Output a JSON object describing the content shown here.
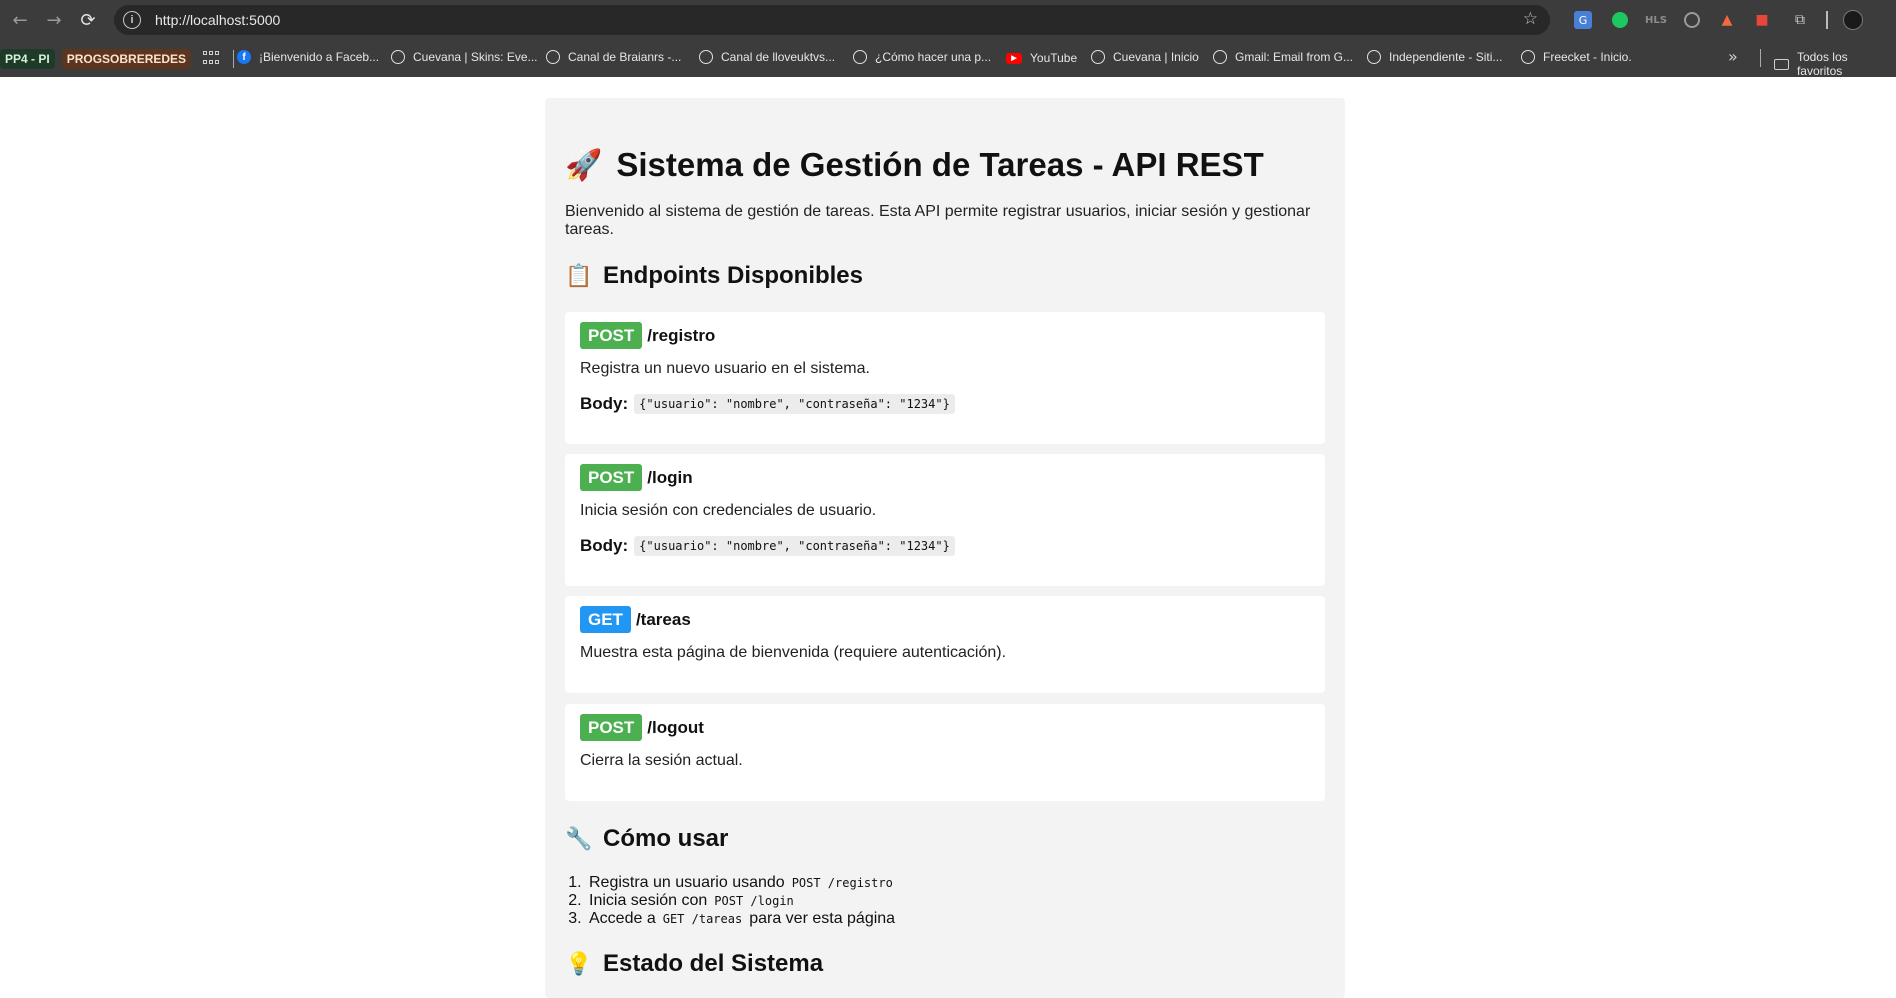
{
  "browser": {
    "url": "http://localhost:5000",
    "bookmark_groups": [
      "PP4 - PI",
      "PROGSOBREREDES"
    ],
    "bookmarks": [
      {
        "label": "¡Bienvenido a Faceb...",
        "icon": "facebook-icon"
      },
      {
        "label": "Cuevana | Skins: Eve...",
        "icon": "globe-icon"
      },
      {
        "label": "Canal de Braianrs -...",
        "icon": "globe-icon"
      },
      {
        "label": "Canal de lloveuktvs...",
        "icon": "globe-icon"
      },
      {
        "label": "¿Cómo hacer una p...",
        "icon": "globe-icon"
      },
      {
        "label": "YouTube",
        "icon": "youtube-icon"
      },
      {
        "label": "Cuevana | Inicio",
        "icon": "globe-icon"
      },
      {
        "label": "Gmail: Email from G...",
        "icon": "globe-icon"
      },
      {
        "label": "Independiente - Siti...",
        "icon": "globe-icon"
      },
      {
        "label": "Freecket - Inicio.",
        "icon": "globe-icon"
      }
    ],
    "all_bookmarks_label": "Todos los favoritos",
    "hls_label": "HLS"
  },
  "page": {
    "title_emoji": "🚀",
    "title": "Sistema de Gestión de Tareas - API REST",
    "intro": "Bienvenido al sistema de gestión de tareas. Esta API permite registrar usuarios, iniciar sesión y gestionar tareas.",
    "endpoints_heading_emoji": "📋",
    "endpoints_heading": "Endpoints Disponibles",
    "endpoints": [
      {
        "method": "POST",
        "path": "/registro",
        "description": "Registra un nuevo usuario en el sistema.",
        "body_label": "Body:",
        "body": "{\"usuario\": \"nombre\", \"contraseña\": \"1234\"}"
      },
      {
        "method": "POST",
        "path": "/login",
        "description": "Inicia sesión con credenciales de usuario.",
        "body_label": "Body:",
        "body": "{\"usuario\": \"nombre\", \"contraseña\": \"1234\"}"
      },
      {
        "method": "GET",
        "path": "/tareas",
        "description": "Muestra esta página de bienvenida (requiere autenticación)."
      },
      {
        "method": "POST",
        "path": "/logout",
        "description": "Cierra la sesión actual."
      }
    ],
    "usage_heading_emoji": "🔧",
    "usage_heading": "Cómo usar",
    "steps": [
      {
        "before": "Registra un usuario usando",
        "code": "POST /registro",
        "after": ""
      },
      {
        "before": "Inicia sesión con",
        "code": "POST /login",
        "after": ""
      },
      {
        "before": "Accede a",
        "code": "GET /tareas",
        "after": "para ver esta página"
      }
    ],
    "status_heading_emoji": "💡",
    "status_heading": "Estado del Sistema"
  },
  "colors": {
    "post": "#4caf50",
    "get": "#2196f3"
  }
}
